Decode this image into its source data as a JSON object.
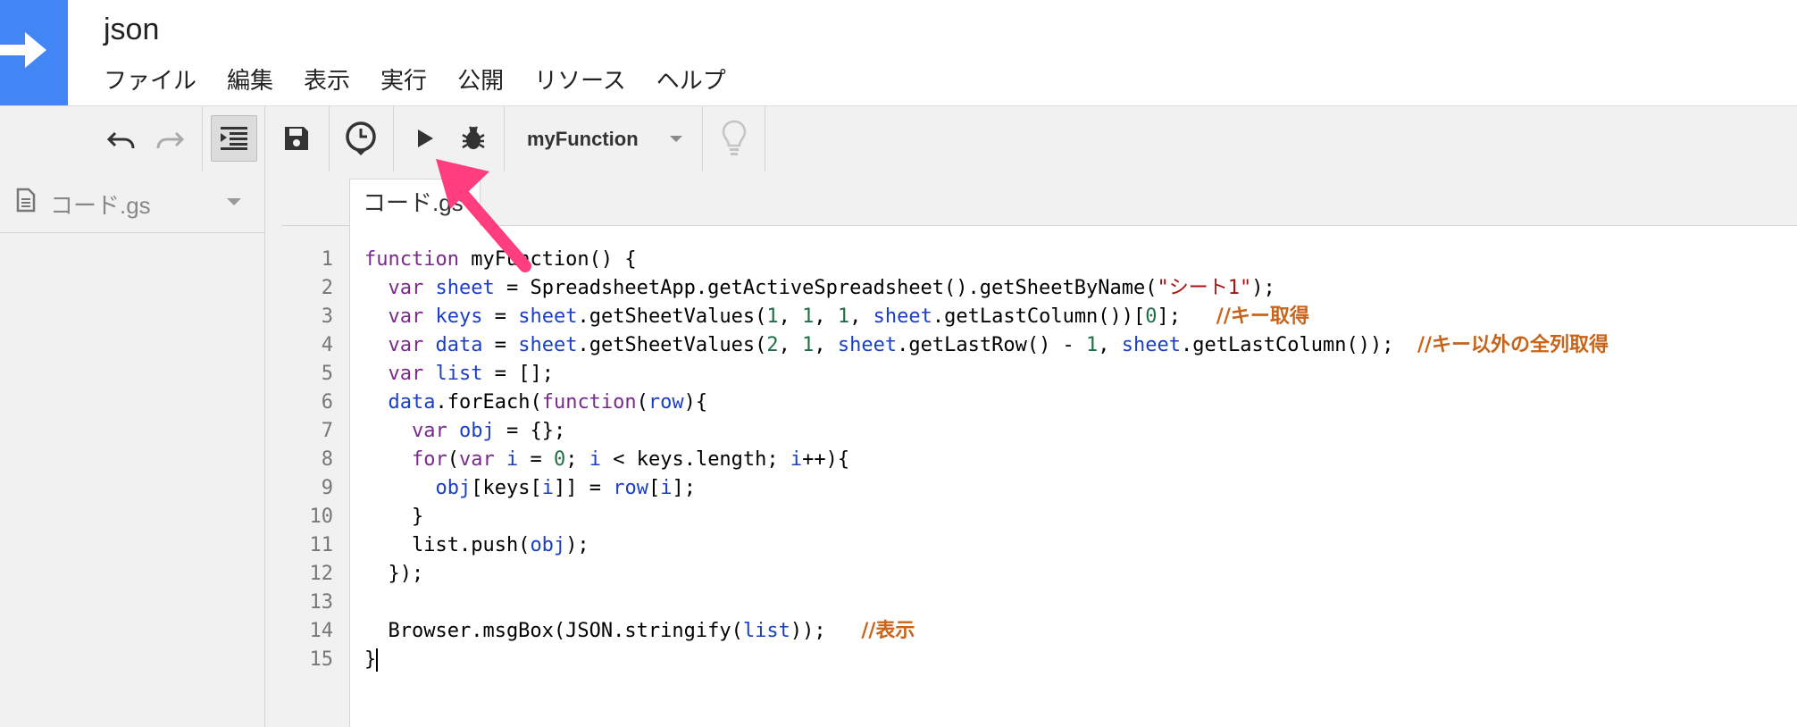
{
  "app": {
    "title": "json"
  },
  "menu": [
    "ファイル",
    "編集",
    "表示",
    "実行",
    "公開",
    "リソース",
    "ヘルプ"
  ],
  "toolbar": {
    "function_name": "myFunction"
  },
  "sidebar": {
    "file": "コード.gs"
  },
  "editor": {
    "tab": "コード.gs",
    "line_numbers": [
      "1",
      "2",
      "3",
      "4",
      "5",
      "6",
      "7",
      "8",
      "9",
      "10",
      "11",
      "12",
      "13",
      "14",
      "15"
    ],
    "code_lines": [
      "function myFunction() {",
      "  var sheet = SpreadsheetApp.getActiveSpreadsheet().getSheetByName(\"シート1\");",
      "  var keys = sheet.getSheetValues(1, 1, 1, sheet.getLastColumn())[0];   //キー取得",
      "  var data = sheet.getSheetValues(2, 1, sheet.getLastRow() - 1, sheet.getLastColumn());  //キー以外の全列取得",
      "  var list = [];",
      "  data.forEach(function(row){",
      "    var obj = {};",
      "    for(var i = 0; i < keys.length; i++){",
      "      obj[keys[i]] = row[i];",
      "    }",
      "    list.push(obj);",
      "  });",
      "",
      "  Browser.msgBox(JSON.stringify(list));   //表示",
      "}"
    ]
  },
  "colors": {
    "logo": "#4285f4",
    "keyword": "#7a2a8d",
    "variable": "#1a3ec8",
    "string": "#aa1111",
    "number": "#1f6f45",
    "comment": "#c8641a",
    "annotation_arrow": "#ff3d7f"
  }
}
